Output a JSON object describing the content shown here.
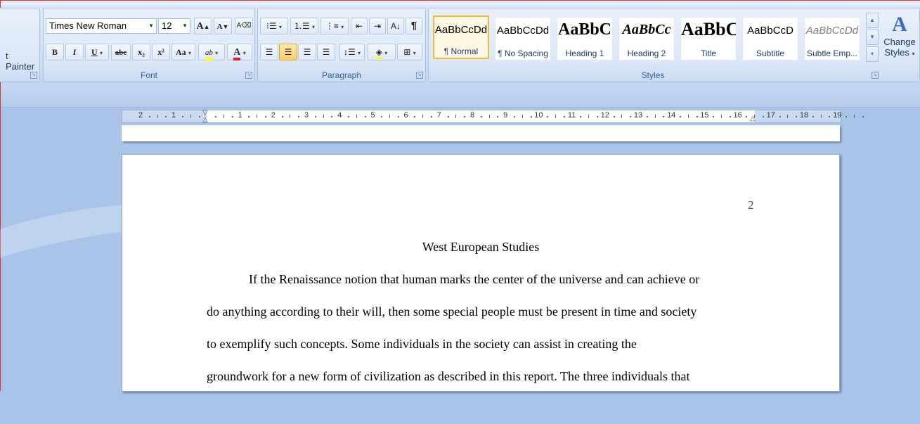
{
  "clipboard": {
    "format_painter_label": "t Painter"
  },
  "font": {
    "group_label": "Font",
    "name": "Times New Roman",
    "size": "12",
    "grow_label": "A",
    "shrink_label": "A",
    "bold_label": "B",
    "italic_label": "I",
    "underline_label": "U",
    "strikethrough_label": "abc",
    "subscript_label": "x₂",
    "superscript_label": "x²",
    "change_case_label": "Aa",
    "highlight_label": "ab",
    "font_color_label": "A",
    "highlight_color": "#ffff00",
    "font_color": "#e02020"
  },
  "paragraph": {
    "group_label": "Paragraph",
    "show_marks_label": "¶"
  },
  "styles": {
    "group_label": "Styles",
    "items": [
      {
        "sample": "AaBbCcDd",
        "name": "¶ Normal"
      },
      {
        "sample": "AaBbCcDd",
        "name": "¶ No Spacing"
      },
      {
        "sample": "AaBbC",
        "name": "Heading 1"
      },
      {
        "sample": "AaBbCc",
        "name": "Heading 2"
      },
      {
        "sample": "AaBbC",
        "name": "Title"
      },
      {
        "sample": "AaBbCcD",
        "name": "Subtitle"
      },
      {
        "sample": "AaBbCcDd",
        "name": "Subtle Emp..."
      }
    ],
    "change_styles_line1": "Change",
    "change_styles_line2": "Styles"
  },
  "ruler": {
    "labels": [
      "2",
      "1",
      "",
      "1",
      "2",
      "3",
      "4",
      "5",
      "6",
      "7",
      "8",
      "9",
      "10",
      "11",
      "12",
      "13",
      "14",
      "15",
      "16",
      "17",
      "18",
      "19"
    ]
  },
  "document": {
    "page_number": "2",
    "title": "West European Studies",
    "lines": [
      "If the Renaissance notion that human marks the center of the universe and can achieve or",
      "do anything according to their will, then some special people must be present in time and society",
      "to exemplify such concepts. Some individuals in the society can assist in creating the",
      "groundwork for a new form of civilization as described in this report. The three individuals that"
    ]
  }
}
